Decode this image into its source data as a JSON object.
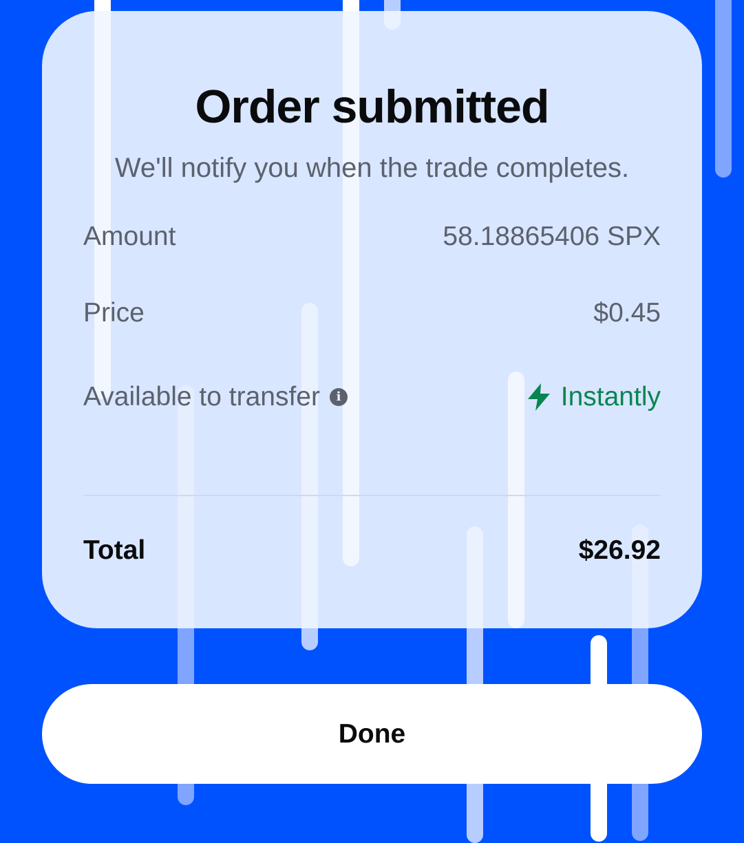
{
  "order_card": {
    "title": "Order submitted",
    "subtitle": "We'll notify you when the trade completes.",
    "amount_label": "Amount",
    "amount_value": "58.18865406 SPX",
    "price_label": "Price",
    "price_value": "$0.45",
    "transfer_label": "Available to transfer",
    "transfer_value": "Instantly",
    "total_label": "Total",
    "total_value": "$26.92"
  },
  "actions": {
    "done_label": "Done"
  },
  "colors": {
    "background": "#0052ff",
    "card": "#f1f6ff",
    "positive": "#098551",
    "text_primary": "#0a0b0d",
    "text_secondary": "#5b616e"
  },
  "icons": {
    "info": "info-icon",
    "instant": "lightning-bolt-icon"
  }
}
